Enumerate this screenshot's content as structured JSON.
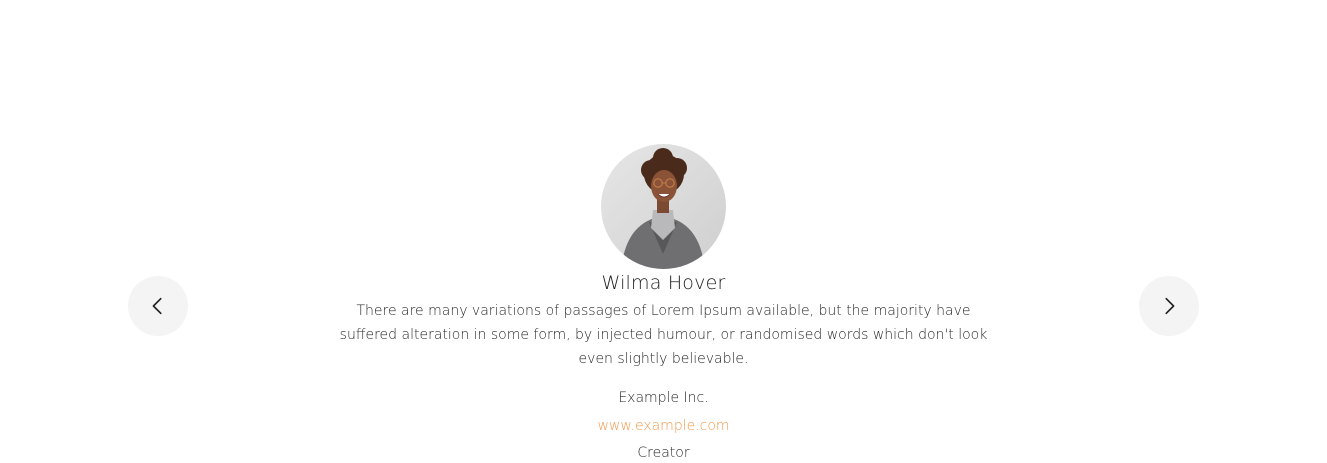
{
  "navigation": {
    "prev_icon": "chevron-left-icon",
    "next_icon": "chevron-right-icon"
  },
  "testimonial": {
    "name": "Wilma Hover",
    "quote": "There are many variations of passages of Lorem Ipsum available, but the majority have suffered alteration in some form, by injected humour, or randomised words which don't look even slightly believable.",
    "company": "Example Inc.",
    "website": "www.example.com",
    "role": "Creator"
  },
  "colors": {
    "accent": "#f09a4d",
    "nav_background": "#f4f4f4",
    "text": "#1f1f1f"
  }
}
